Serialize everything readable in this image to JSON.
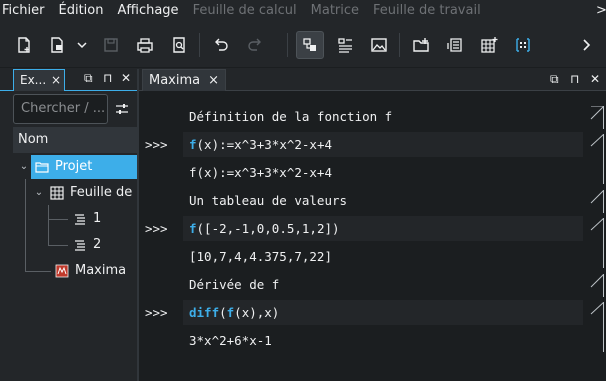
{
  "menubar": {
    "items": [
      {
        "label": "Fichier",
        "enabled": true
      },
      {
        "label": "Édition",
        "enabled": true
      },
      {
        "label": "Affichage",
        "enabled": true
      },
      {
        "label": "Feuille de calcul",
        "enabled": false
      },
      {
        "label": "Matrice",
        "enabled": false
      },
      {
        "label": "Feuille de travail",
        "enabled": false
      }
    ],
    "more_icon": ">"
  },
  "toolbar": {
    "icons": [
      "new-file-icon",
      "open-file-icon",
      "dropdown-icon",
      "save-icon",
      "print-icon",
      "print-preview-icon",
      "undo-icon",
      "redo-icon",
      "workspace-view-icon",
      "list-view-icon",
      "image-icon",
      "add-folder-icon",
      "add-worksheet-icon",
      "add-spreadsheet-icon",
      "add-matrix-icon",
      "more-icon"
    ]
  },
  "explorer": {
    "tab_label": "Ex...",
    "close": "×",
    "search_placeholder": "Chercher / ...",
    "column_header": "Nom",
    "tree": {
      "project": "Projet",
      "spreadsheet": "Feuille de",
      "col1": "1",
      "col2": "2",
      "maxima": "Maxima"
    }
  },
  "worksheet": {
    "tab_label": "Maxima",
    "close": "×",
    "prompt": ">>>",
    "entries": [
      {
        "text": "Définition de la fonction f"
      },
      {
        "cmd_kw": "f",
        "cmd_rest": "(x):=x^3+3*x^2-x+4"
      },
      {
        "text": "f(x):=x^3+3*x^2-x+4"
      },
      {
        "text": "Un tableau de valeurs"
      },
      {
        "cmd_kw": "f",
        "cmd_rest": "([-2,-1,0,0.5,1,2])"
      },
      {
        "text": "[10,7,4,4.375,7,22]"
      },
      {
        "text": "Dérivée de f"
      },
      {
        "cmd_kw": "diff",
        "cmd_mid": "(",
        "cmd_kw2": "f",
        "cmd_rest": "(x),x)"
      },
      {
        "text": "3*x^2+6*x-1"
      }
    ]
  },
  "colors": {
    "accent": "#3daee9",
    "background": "#1b1e20",
    "panel": "#232629"
  }
}
